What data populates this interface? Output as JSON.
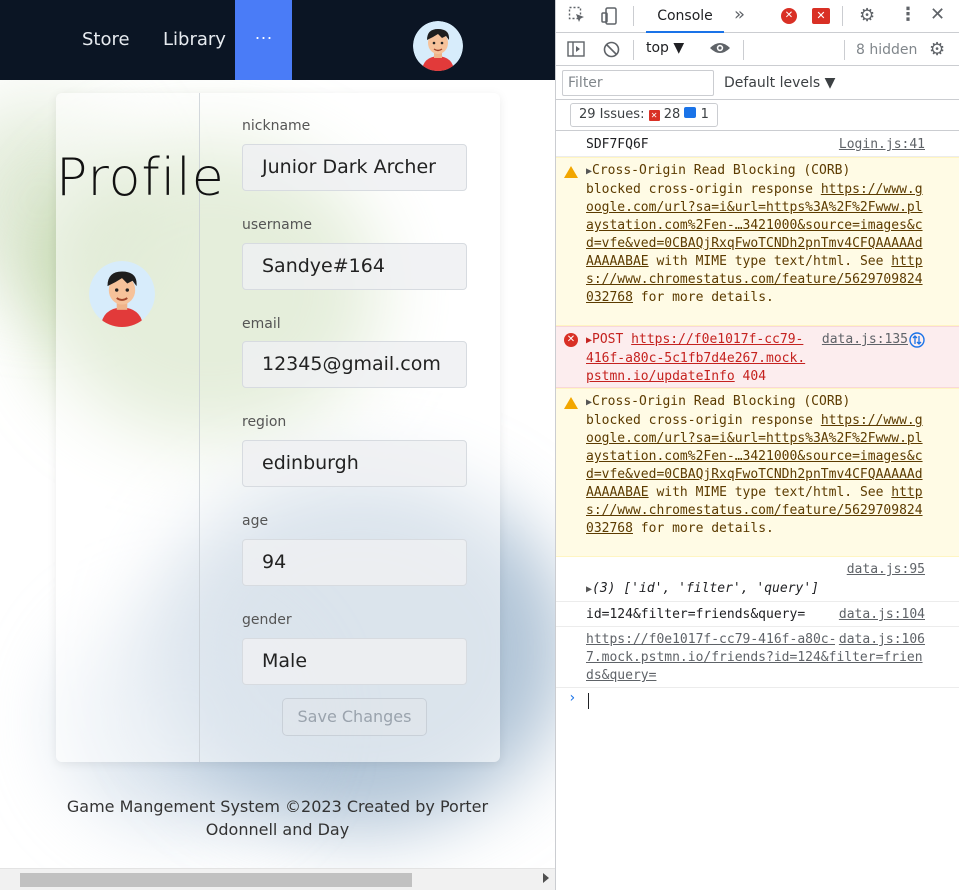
{
  "nav": {
    "store": "Store",
    "library": "Library",
    "more": "···"
  },
  "profile": {
    "title": "Profile",
    "fields": [
      {
        "label": "nickname",
        "value": "Junior Dark Archer"
      },
      {
        "label": "username",
        "value": "Sandye#164"
      },
      {
        "label": "email",
        "value": "12345@gmail.com"
      },
      {
        "label": "region",
        "value": "edinburgh"
      },
      {
        "label": "age",
        "value": "94"
      },
      {
        "label": "gender",
        "value": "Male"
      }
    ],
    "save_label": "Save Changes"
  },
  "footer": {
    "line1": "Game Mangement System ©2023 Created by Porter",
    "line2": "Odonnell and Day"
  },
  "devtools": {
    "tab": "Console",
    "context": "top ▼",
    "hidden": "8 hidden",
    "filter_placeholder": "Filter",
    "levels": "Default levels ▼",
    "issues_label": "29 Issues:",
    "issues_errors": "28",
    "issues_info": "1",
    "colors": {
      "accent": "#1a73e8",
      "error": "#d93025",
      "warning": "#f2a600"
    },
    "messages": [
      {
        "type": "log",
        "text": "SDF7FQ6F",
        "source": "Login.js:41"
      },
      {
        "type": "warning",
        "title": "Cross-Origin Read Blocking (CORB)",
        "text_pre": "blocked cross-origin response ",
        "url": "https://www.google.com/url?sa=i&url=https%3A%2F%2Fwww.playstation.com%2Fen-…3421000&source=images&cd=vfe&ved=0CBAQjRxqFwoTCNDh2pnTmv4CFQAAAAAdAAAAABAE",
        "text_mid": " with MIME type text/html. See ",
        "url2": "https://www.chromestatus.com/feature/5629709824032768",
        "text_post": " for more details."
      },
      {
        "type": "error",
        "method": "POST",
        "url": "https://f0e1017f-cc79-416f-a80c-5c1fb7d4e267.mock.pstmn.io/updateInfo",
        "status": "404",
        "source": "data.js:135"
      },
      {
        "type": "warning",
        "title": "Cross-Origin Read Blocking (CORB)",
        "text_pre": "blocked cross-origin response ",
        "url": "https://www.google.com/url?sa=i&url=https%3A%2F%2Fwww.playstation.com%2Fen-…3421000&source=images&cd=vfe&ved=0CBAQjRxqFwoTCNDh2pnTmv4CFQAAAAAdAAAAABAE",
        "text_mid": " with MIME type text/html. See ",
        "url2": "https://www.chromestatus.com/feature/5629709824032768",
        "text_post": " for more details."
      },
      {
        "type": "log",
        "text": "(3) ['id', 'filter', 'query']",
        "source": "data.js:95"
      },
      {
        "type": "log",
        "text": "id=124&filter=friends&query=",
        "source": "data.js:104"
      },
      {
        "type": "log",
        "text": "https://f0e1017f-cc79-416f-a80c-5c1fb7d4e267.mock.pstmn.io/friends?id=124&filter=friends&query=",
        "source": "data.js:106"
      }
    ]
  }
}
